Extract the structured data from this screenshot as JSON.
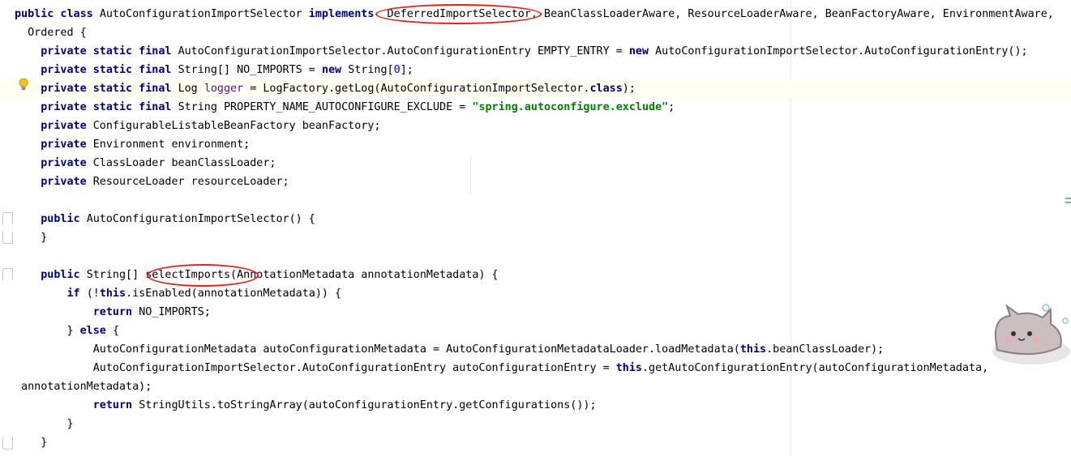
{
  "code": {
    "lines": [
      [
        [
          "kw",
          "public class "
        ],
        [
          "t",
          "AutoConfigurationImportSelector "
        ],
        [
          "kw",
          "implements "
        ],
        [
          "t",
          " DeferredImportSelector, BeanClassLoaderAware, ResourceLoaderAware, BeanFactoryAware, EnvironmentAware,"
        ]
      ],
      [
        [
          "t",
          "  Ordered {"
        ]
      ],
      [
        [
          "t",
          "    "
        ],
        [
          "kw",
          "private static final "
        ],
        [
          "t",
          "AutoConfigurationImportSelector.AutoConfigurationEntry EMPTY_ENTRY = "
        ],
        [
          "kw",
          "new "
        ],
        [
          "t",
          "AutoConfigurationImportSelector.AutoConfigurationEntry();"
        ]
      ],
      [
        [
          "t",
          "    "
        ],
        [
          "kw",
          "private static final "
        ],
        [
          "t",
          "String[] NO_IMPORTS = "
        ],
        [
          "kw",
          "new "
        ],
        [
          "t",
          "String["
        ],
        [
          "num",
          "0"
        ],
        [
          "t",
          "];"
        ]
      ],
      [
        [
          "t",
          "    "
        ],
        [
          "kw",
          "private static final "
        ],
        [
          "t",
          "Log "
        ],
        [
          "fld",
          "logger"
        ],
        [
          "t",
          " = LogFactory.getLog(AutoConfigurationImportSelector."
        ],
        [
          "kw",
          "class"
        ],
        [
          "t",
          ");"
        ]
      ],
      [
        [
          "t",
          "    "
        ],
        [
          "kw",
          "private static final "
        ],
        [
          "t",
          "String PROPERTY_NAME_AUTOCONFIGURE_EXCLUDE = "
        ],
        [
          "str",
          "\"spring.autoconfigure.exclude\""
        ],
        [
          "t",
          ";"
        ]
      ],
      [
        [
          "t",
          "    "
        ],
        [
          "kw",
          "private "
        ],
        [
          "t",
          "ConfigurableListableBeanFactory beanFactory;"
        ]
      ],
      [
        [
          "t",
          "    "
        ],
        [
          "kw",
          "private "
        ],
        [
          "t",
          "Environment environment;"
        ]
      ],
      [
        [
          "t",
          "    "
        ],
        [
          "kw",
          "private "
        ],
        [
          "t",
          "ClassLoader beanClassLoader;"
        ]
      ],
      [
        [
          "t",
          "    "
        ],
        [
          "kw",
          "private "
        ],
        [
          "t",
          "ResourceLoader resourceLoader;"
        ]
      ],
      [
        [
          "t",
          ""
        ]
      ],
      [
        [
          "t",
          "    "
        ],
        [
          "kw",
          "public "
        ],
        [
          "t",
          "AutoConfigurationImportSelector() {"
        ]
      ],
      [
        [
          "t",
          "    }"
        ]
      ],
      [
        [
          "t",
          ""
        ]
      ],
      [
        [
          "t",
          "    "
        ],
        [
          "kw",
          "public "
        ],
        [
          "t",
          "String[] selectImports(AnnotationMetadata annotationMetadata) {"
        ]
      ],
      [
        [
          "t",
          "        "
        ],
        [
          "kw",
          "if "
        ],
        [
          "t",
          "(!"
        ],
        [
          "kw",
          "this"
        ],
        [
          "t",
          ".isEnabled(annotationMetadata)) {"
        ]
      ],
      [
        [
          "t",
          "            "
        ],
        [
          "kw",
          "return "
        ],
        [
          "t",
          "NO_IMPORTS;"
        ]
      ],
      [
        [
          "t",
          "        } "
        ],
        [
          "kw",
          "else "
        ],
        [
          "t",
          "{"
        ]
      ],
      [
        [
          "t",
          "            AutoConfigurationMetadata autoConfigurationMetadata = AutoConfigurationMetadataLoader.loadMetadata("
        ],
        [
          "kw",
          "this"
        ],
        [
          "t",
          ".beanClassLoader);"
        ]
      ],
      [
        [
          "t",
          "            AutoConfigurationImportSelector.AutoConfigurationEntry autoConfigurationEntry = "
        ],
        [
          "kw",
          "this"
        ],
        [
          "t",
          ".getAutoConfigurationEntry(autoConfigurationMetadata,"
        ]
      ],
      [
        [
          "t",
          " annotationMetadata);"
        ]
      ],
      [
        [
          "t",
          "            "
        ],
        [
          "kw",
          "return "
        ],
        [
          "t",
          "StringUtils.toStringArray(autoConfigurationEntry.getConfigurations());"
        ]
      ],
      [
        [
          "t",
          "        }"
        ]
      ],
      [
        [
          "t",
          "    }"
        ]
      ]
    ]
  },
  "colors": {
    "keyword": "#000080",
    "string": "#008000",
    "number": "#0000ff",
    "field": "#660e7a",
    "highlight_line": "#fffff2",
    "annotation_ellipse": "#e0211a"
  },
  "icons": {
    "intention": "lightbulb-icon",
    "fold_open": "fold-start-icon",
    "fold_close": "fold-end-icon",
    "sticker": "cat-sticker-icon"
  }
}
